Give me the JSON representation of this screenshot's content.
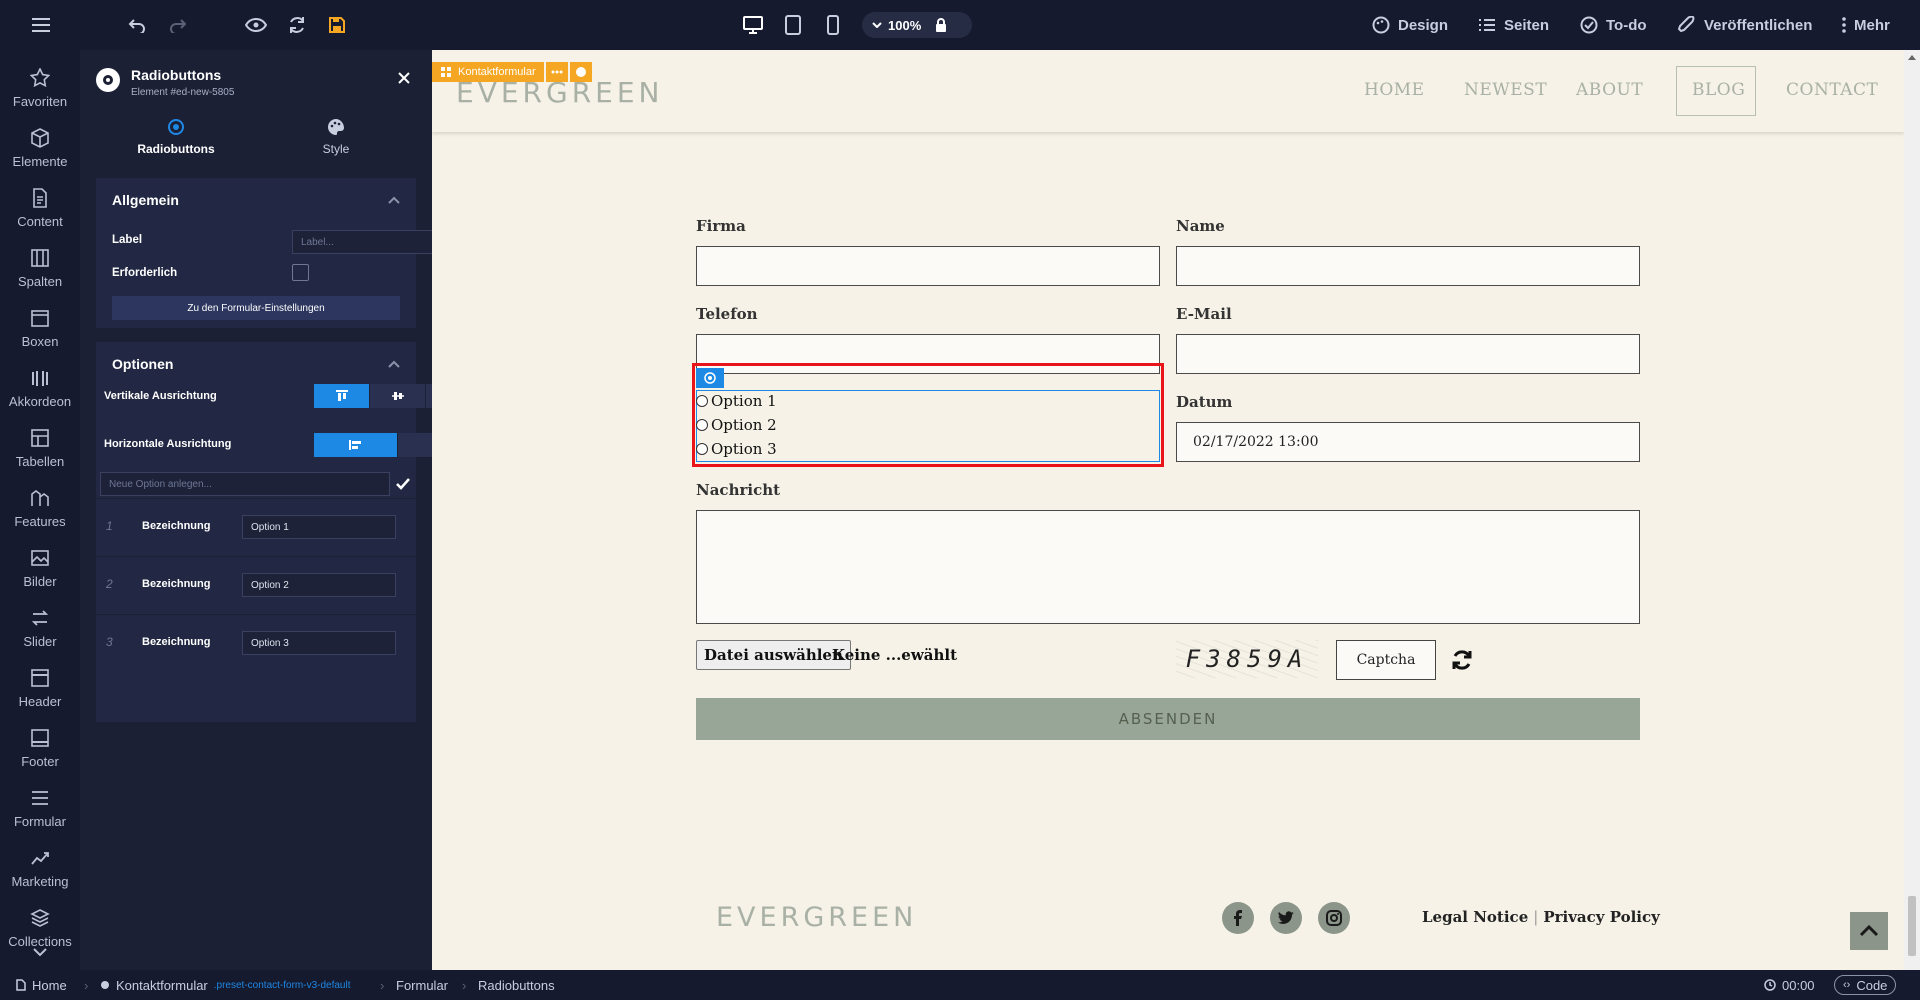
{
  "toolbar": {
    "zoom": "100%",
    "design_label": "Design",
    "pages_label": "Seiten",
    "todo_label": "To-do",
    "publish_label": "Veröffentlichen",
    "more_label": "Mehr"
  },
  "rail": {
    "items": [
      {
        "label": "Favoriten",
        "icon": "star-icon"
      },
      {
        "label": "Elemente",
        "icon": "cube-icon"
      },
      {
        "label": "Content",
        "icon": "document-icon"
      },
      {
        "label": "Spalten",
        "icon": "columns-icon"
      },
      {
        "label": "Boxen",
        "icon": "box-icon"
      },
      {
        "label": "Akkordeon",
        "icon": "accordion-icon"
      },
      {
        "label": "Tabellen",
        "icon": "table-icon"
      },
      {
        "label": "Features",
        "icon": "features-icon"
      },
      {
        "label": "Bilder",
        "icon": "image-icon"
      },
      {
        "label": "Slider",
        "icon": "slider-icon"
      },
      {
        "label": "Header",
        "icon": "header-icon"
      },
      {
        "label": "Footer",
        "icon": "footer-icon"
      },
      {
        "label": "Formular",
        "icon": "form-icon"
      },
      {
        "label": "Marketing",
        "icon": "chart-icon"
      },
      {
        "label": "Collections",
        "icon": "layers-icon"
      }
    ]
  },
  "panel": {
    "title": "Radiobuttons",
    "subtitle": "Element #ed-new-5805",
    "tabs": [
      {
        "label": "Radiobuttons",
        "active": true
      },
      {
        "label": "Style",
        "active": false
      }
    ],
    "general": {
      "heading": "Allgemein",
      "label_caption": "Label",
      "label_placeholder": "Label...",
      "required_caption": "Erforderlich",
      "form_settings_button": "Zu den Formular-Einstellungen"
    },
    "options": {
      "heading": "Optionen",
      "vertical_caption": "Vertikale Ausrichtung",
      "horizontal_caption": "Horizontale Ausrichtung",
      "new_option_placeholder": "Neue Option anlegen...",
      "rows": [
        {
          "index": "1",
          "caption": "Bezeichnung",
          "value": "Option 1"
        },
        {
          "index": "2",
          "caption": "Bezeichnung",
          "value": "Option 2"
        },
        {
          "index": "3",
          "caption": "Bezeichnung",
          "value": "Option 3"
        }
      ]
    }
  },
  "canvas": {
    "tag_label": "Kontaktformular",
    "logo": "EVERGREEN",
    "nav": [
      "HOME",
      "NEWEST",
      "ABOUT",
      "BLOG",
      "CONTACT"
    ],
    "form": {
      "firma": "Firma",
      "name": "Name",
      "telefon": "Telefon",
      "email": "E-Mail",
      "datum": "Datum",
      "datum_value": "02/17/2022 13:00",
      "nachricht": "Nachricht",
      "radio_options": [
        "Option 1",
        "Option 2",
        "Option 3"
      ],
      "file_button": "Datei auswählen",
      "file_status": "Keine ...ewählt",
      "captcha_text": "F3859A",
      "captcha_field": "Captcha",
      "submit": "ABSENDEN"
    },
    "footer": {
      "logo": "EVERGREEN",
      "legal": "Legal Notice",
      "separator": "|",
      "privacy": "Privacy Policy"
    }
  },
  "bottombar": {
    "breadcrumbs": [
      {
        "label": "Home"
      },
      {
        "label": "Kontaktformular",
        "sub": ".preset-contact-form-v3-default"
      },
      {
        "label": "Formular"
      },
      {
        "label": "Radiobuttons"
      }
    ],
    "timer": "00:00",
    "code_label": "Code"
  },
  "colors": {
    "accent": "#1e88e5",
    "orange": "#f5a623",
    "highlight_red": "#e8141a",
    "submit_bg": "#98a698"
  }
}
